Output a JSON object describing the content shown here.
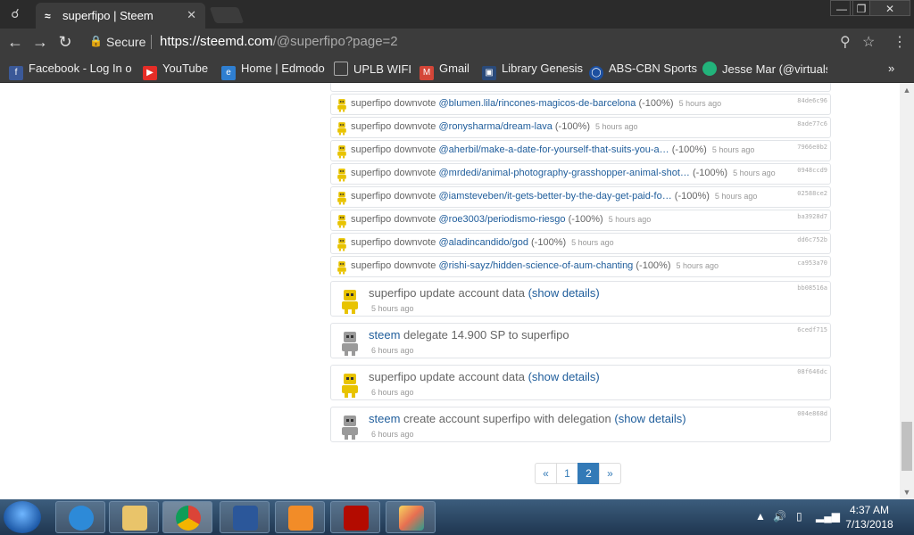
{
  "browser": {
    "tab_title": "superfipo | Steem",
    "url_host": "https://steemd.com",
    "url_path": "/@superfipo?page=2",
    "secure_label": "Secure",
    "bookmarks": [
      {
        "label": "Facebook - Log In o",
        "icon": "facebook-icon",
        "color": "#3b5998"
      },
      {
        "label": "YouTube",
        "icon": "youtube-icon",
        "color": "#e52d27"
      },
      {
        "label": "Home | Edmodo",
        "icon": "edmodo-icon",
        "color": "#2f7fd1"
      },
      {
        "label": "UPLB WIFI",
        "icon": "page-icon",
        "color": "#666666"
      },
      {
        "label": "Gmail",
        "icon": "gmail-icon",
        "color": "#d44638"
      },
      {
        "label": "Library Genesis",
        "icon": "library-icon",
        "color": "#2a4a7a"
      },
      {
        "label": "ABS-CBN Sports",
        "icon": "abs-cbn-icon",
        "color": "#1c4fa0"
      },
      {
        "label": "Jesse Mar (@virtuals",
        "icon": "steem-icon",
        "color": "#22b37b"
      }
    ]
  },
  "operations": [
    {
      "type": "downvote",
      "actor": "superfipo",
      "action": "downvote",
      "link": "@blumen.lila/rincones-magicos-de-barcelona",
      "pct": "(-100%)",
      "time": "5 hours ago",
      "hash": "84de6c96"
    },
    {
      "type": "downvote",
      "actor": "superfipo",
      "action": "downvote",
      "link": "@ronysharma/dream-lava",
      "pct": "(-100%)",
      "time": "5 hours ago",
      "hash": "8ade77c6"
    },
    {
      "type": "downvote",
      "actor": "superfipo",
      "action": "downvote",
      "link": "@aherbil/make-a-date-for-yourself-that-suits-you-a…",
      "pct": "(-100%)",
      "time": "5 hours ago",
      "hash": "7966e0b2"
    },
    {
      "type": "downvote",
      "actor": "superfipo",
      "action": "downvote",
      "link": "@mrdedi/animal-photography-grasshopper-animal-shot…",
      "pct": "(-100%)",
      "time": "5 hours ago",
      "hash": "0948ccd9"
    },
    {
      "type": "downvote",
      "actor": "superfipo",
      "action": "downvote",
      "link": "@iamsteveben/it-gets-better-by-the-day-get-paid-fo…",
      "pct": "(-100%)",
      "time": "5 hours ago",
      "hash": "02588ce2"
    },
    {
      "type": "downvote",
      "actor": "superfipo",
      "action": "downvote",
      "link": "@roe3003/periodismo-riesgo",
      "pct": "(-100%)",
      "time": "5 hours ago",
      "hash": "ba3928d7"
    },
    {
      "type": "downvote",
      "actor": "superfipo",
      "action": "downvote",
      "link": "@aladincandido/god",
      "pct": "(-100%)",
      "time": "5 hours ago",
      "hash": "dd6c752b"
    },
    {
      "type": "downvote",
      "actor": "superfipo",
      "action": "downvote",
      "link": "@rishi-sayz/hidden-science-of-aum-chanting",
      "pct": "(-100%)",
      "time": "5 hours ago",
      "hash": "ca953a70"
    }
  ],
  "big_operations": [
    {
      "actor": "superfipo",
      "actor_is_link": false,
      "text": "update account data",
      "details": "(show details)",
      "time": "5 hours ago",
      "hash": "bb08516a",
      "avatar": "yellow"
    },
    {
      "actor": "steem",
      "actor_is_link": true,
      "text": "delegate 14.900 SP to superfipo",
      "details": "",
      "time": "6 hours ago",
      "hash": "6cedf715",
      "avatar": "gray"
    },
    {
      "actor": "superfipo",
      "actor_is_link": false,
      "text": "update account data",
      "details": "(show details)",
      "time": "6 hours ago",
      "hash": "08f646dc",
      "avatar": "yellow"
    },
    {
      "actor": "steem",
      "actor_is_link": true,
      "text": "create account superfipo with delegation",
      "details": "(show details)",
      "time": "6 hours ago",
      "hash": "004e868d",
      "avatar": "gray"
    }
  ],
  "pagination": {
    "prev": "«",
    "pages": [
      "1",
      "2"
    ],
    "active": "2",
    "next": "»"
  },
  "taskbar": {
    "time": "4:37 AM",
    "date": "7/13/2018"
  },
  "colors": {
    "link": "#1f5d9b",
    "active_page": "#337ab7",
    "robot_yellow": "#e8c300",
    "robot_gray": "#9a9a9a"
  }
}
